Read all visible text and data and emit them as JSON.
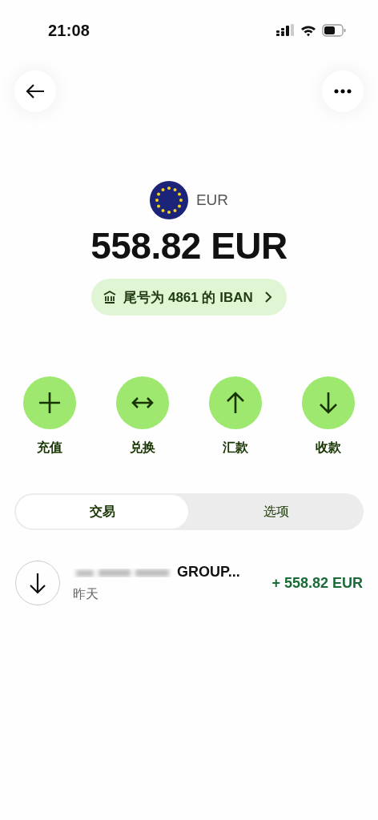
{
  "status_bar": {
    "time": "21:08"
  },
  "account": {
    "currency": "EUR",
    "balance": "558.82 EUR",
    "iban_button": "尾号为 4861 的 IBAN"
  },
  "actions": [
    {
      "kind": "add",
      "label": "充值"
    },
    {
      "kind": "exchange",
      "label": "兑换"
    },
    {
      "kind": "send",
      "label": "汇款"
    },
    {
      "kind": "receive",
      "label": "收款"
    }
  ],
  "tabs": [
    {
      "label": "交易",
      "selected": true
    },
    {
      "label": "选项",
      "selected": false
    }
  ],
  "transactions": [
    {
      "kind": "incoming",
      "name": "GROUP...",
      "date": "昨天",
      "amount": "+ 558.82 EUR"
    }
  ]
}
